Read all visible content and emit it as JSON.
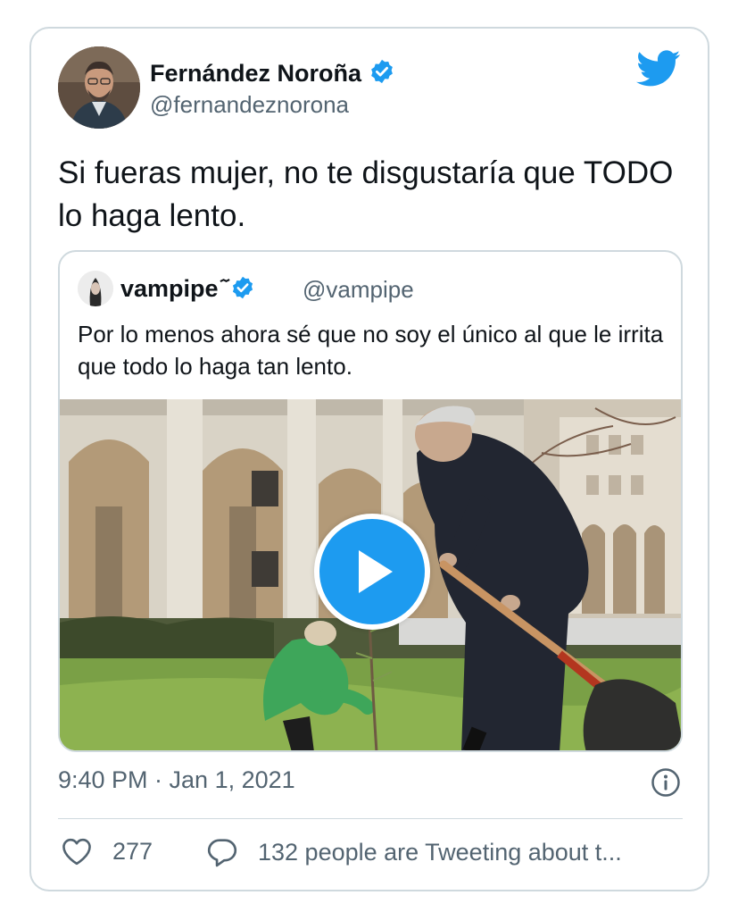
{
  "author": {
    "name": "Fernández Noroña",
    "handle": "@fernandeznorona"
  },
  "tweet": {
    "text": "Si fueras mujer, no te disgustaría que TODO lo haga lento."
  },
  "quoted_tweet": {
    "name": "vampipe ᷉",
    "handle": "@vampipe",
    "text": "Por lo menos ahora sé que no soy el único al que le irrita que todo lo haga tan lento."
  },
  "timestamp": "9:40 PM · Jan 1, 2021",
  "actions": {
    "likes": "277",
    "conversation": "132 people are Tweeting about t..."
  },
  "colors": {
    "twitter_blue": "#1d9bf0",
    "secondary_text": "#536471",
    "border": "#cfd9de"
  },
  "icons": [
    "twitter-bird-icon",
    "verified-badge-icon",
    "play-icon",
    "info-icon",
    "heart-icon",
    "reply-bubble-icon"
  ]
}
